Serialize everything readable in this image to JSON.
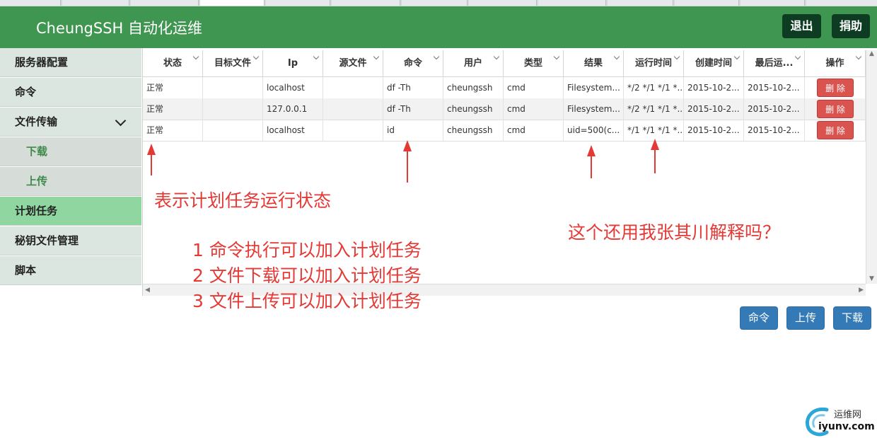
{
  "header": {
    "title": "CheungSSH 自动化运维",
    "logout_label": "退出",
    "donate_label": "捐助"
  },
  "sidebar": {
    "items": [
      {
        "label": "服务器配置"
      },
      {
        "label": "命令"
      },
      {
        "label": "文件传输"
      },
      {
        "label": "下载"
      },
      {
        "label": "上传"
      },
      {
        "label": "计划任务"
      },
      {
        "label": "秘钥文件管理"
      },
      {
        "label": "脚本"
      }
    ]
  },
  "table": {
    "columns": [
      "状态",
      "目标文件",
      "Ip",
      "源文件",
      "命令",
      "用户",
      "类型",
      "结果",
      "运行时间",
      "创建时间",
      "最后运...",
      "操作"
    ],
    "rows": [
      [
        "正常",
        "",
        "localhost",
        "",
        "df -Th",
        "cheungssh",
        "cmd",
        "Filesystem...",
        "*/2 */1 */1 *...",
        "2015-10-2...",
        "2015-10-2..."
      ],
      [
        "正常",
        "",
        "127.0.0.1",
        "",
        "df -Th",
        "cheungssh",
        "cmd",
        "Filesystem...",
        "*/2 */1 */1 *...",
        "2015-10-2...",
        "2015-10-2..."
      ],
      [
        "正常",
        "",
        "localhost",
        "",
        "id",
        "cheungssh",
        "cmd",
        "uid=500(c...",
        "*/1 */1 */1 *...",
        "2015-10-2...",
        "2015-10-2..."
      ]
    ],
    "delete_label": "删 除"
  },
  "annotations": {
    "status_note": "表示计划任务运行状态",
    "list": [
      "1 命令执行可以加入计划任务",
      "2 文件下载可以加入计划任务",
      "3 文件上传可以加入计划任务"
    ],
    "question": "这个还用我张其川解释吗？"
  },
  "bottom_buttons": {
    "command": "命令",
    "upload": "上传",
    "download": "下载"
  },
  "watermark": {
    "name": "运维网",
    "domain": "iyunv.com"
  },
  "colors": {
    "header": "#3f9650",
    "active_nav": "#8fd6a0",
    "danger": "#d9534f",
    "primary": "#337ab7",
    "annotation": "#e53935"
  }
}
